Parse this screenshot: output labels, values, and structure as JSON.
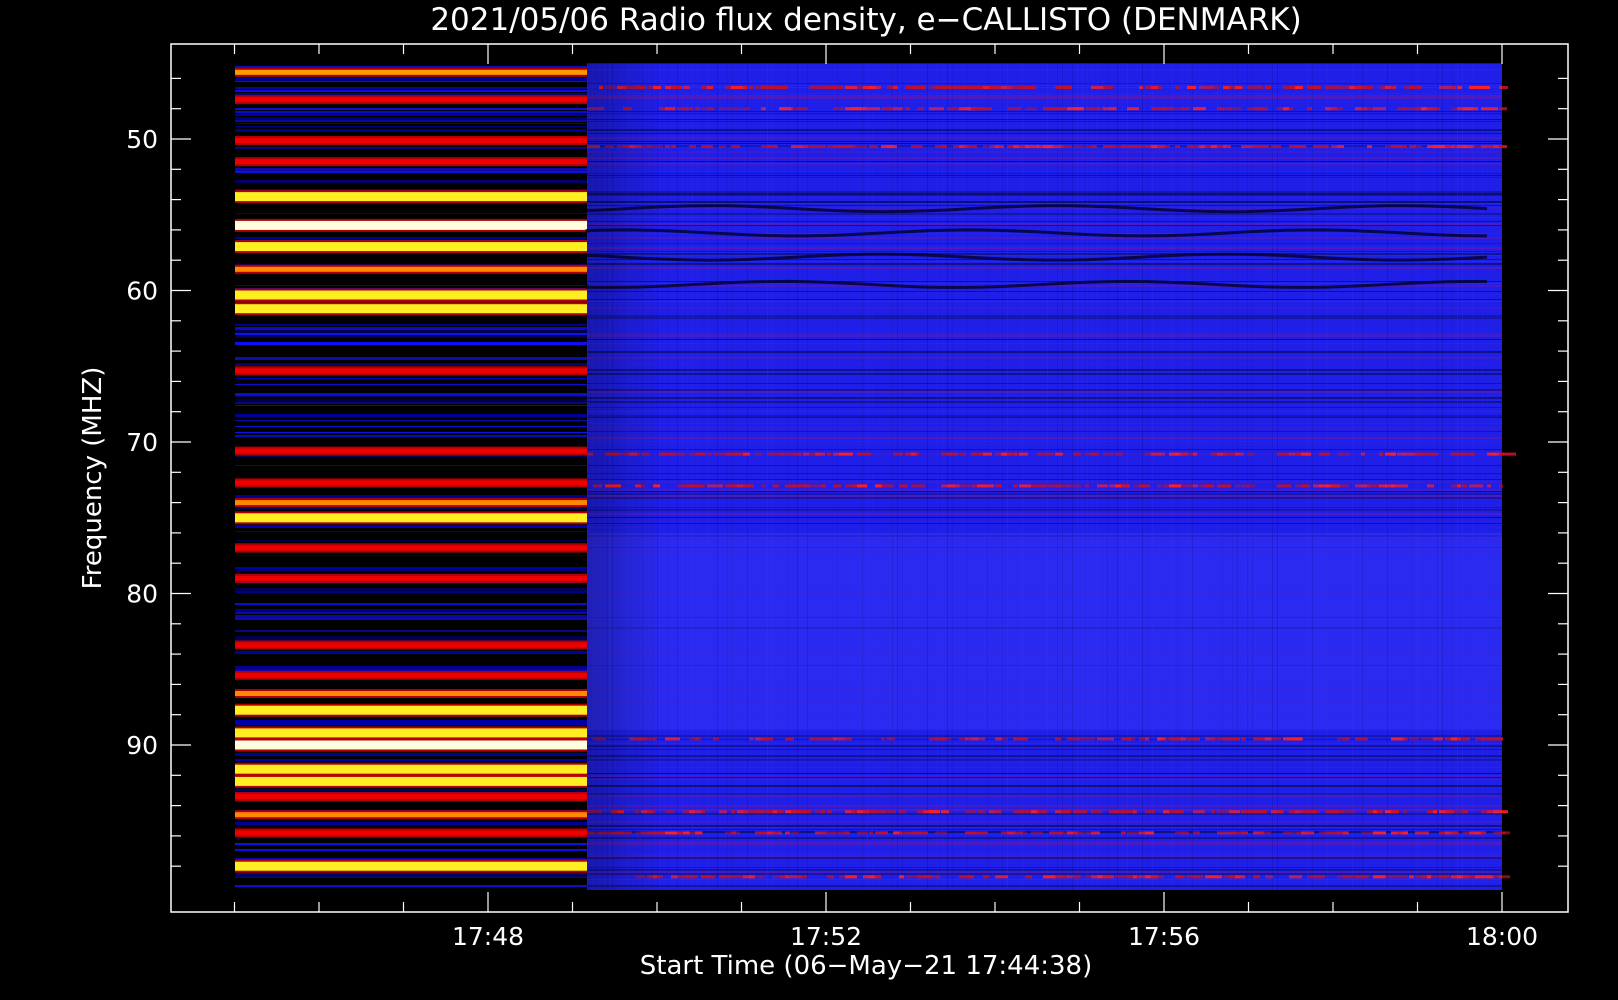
{
  "chart_data": {
    "type": "heatmap",
    "title": "2021/05/06  Radio flux density, e−CALLISTO (DENMARK)",
    "xlabel": "Start Time (06−May−21 17:44:38)",
    "ylabel": "Frequency (MHZ)",
    "x_range_minutes": [
      "17:44:38",
      "18:00:00"
    ],
    "ylim": [
      45.3,
      99.7
    ],
    "y_axis_inverted": true,
    "x_ticks": [
      {
        "value": "17:48",
        "minute": 48
      },
      {
        "value": "17:52",
        "minute": 52
      },
      {
        "value": "17:56",
        "minute": 56
      },
      {
        "value": "18:00",
        "minute": 60
      }
    ],
    "x_minor_step_min": 1,
    "y_ticks": [
      50,
      60,
      70,
      80,
      90
    ],
    "y_minor_step": 2,
    "colormap": [
      "#000000",
      "#0000ff",
      "#ff0000",
      "#ffff00",
      "#ffffff"
    ],
    "regime_change_time": "17:49:10",
    "segment_1": {
      "description_bands": "high-intensity",
      "bands": [
        {
          "freq": 45.6,
          "level": "red-yellow"
        },
        {
          "freq": 47.4,
          "level": "red"
        },
        {
          "freq": 50.1,
          "level": "red"
        },
        {
          "freq": 51.5,
          "level": "red"
        },
        {
          "freq": 53.8,
          "level": "yellow"
        },
        {
          "freq": 55.7,
          "level": "white"
        },
        {
          "freq": 57.1,
          "level": "yellow"
        },
        {
          "freq": 58.6,
          "level": "orange"
        },
        {
          "freq": 60.3,
          "level": "yellow"
        },
        {
          "freq": 61.2,
          "level": "yellow"
        },
        {
          "freq": 65.3,
          "level": "red"
        },
        {
          "freq": 70.6,
          "level": "red"
        },
        {
          "freq": 72.7,
          "level": "red"
        },
        {
          "freq": 74.0,
          "level": "orange"
        },
        {
          "freq": 75.0,
          "level": "yellow"
        },
        {
          "freq": 77.0,
          "level": "red"
        },
        {
          "freq": 79.0,
          "level": "red"
        },
        {
          "freq": 83.4,
          "level": "red"
        },
        {
          "freq": 85.4,
          "level": "red"
        },
        {
          "freq": 86.6,
          "level": "orange"
        },
        {
          "freq": 87.7,
          "level": "yellow"
        },
        {
          "freq": 89.2,
          "level": "yellow"
        },
        {
          "freq": 90.0,
          "level": "white"
        },
        {
          "freq": 91.6,
          "level": "yellow"
        },
        {
          "freq": 92.4,
          "level": "yellow"
        },
        {
          "freq": 93.4,
          "level": "red"
        },
        {
          "freq": 94.6,
          "level": "orange"
        },
        {
          "freq": 95.8,
          "level": "red"
        },
        {
          "freq": 98.0,
          "level": "yellow"
        }
      ]
    },
    "segment_2": {
      "bands": [
        {
          "freq": 46.6,
          "level": "red"
        },
        {
          "freq": 48.0,
          "level": "red"
        },
        {
          "freq": 50.5,
          "level": "red"
        },
        {
          "freq": 70.8,
          "level": "red"
        },
        {
          "freq": 72.9,
          "level": "red"
        },
        {
          "freq": 89.6,
          "level": "red"
        },
        {
          "freq": 94.4,
          "level": "red"
        },
        {
          "freq": 95.8,
          "level": "red"
        },
        {
          "freq": 98.7,
          "level": "red"
        }
      ]
    }
  }
}
